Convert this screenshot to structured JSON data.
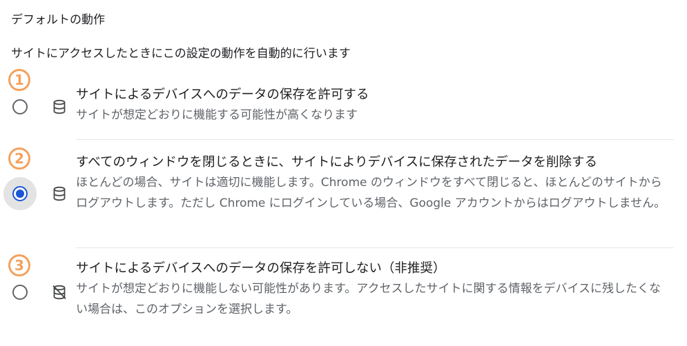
{
  "section": {
    "title": "デフォルトの動作",
    "description": "サイトにアクセスしたときにこの設定の動作を自動的に行います"
  },
  "options": [
    {
      "marker": "1",
      "label": "サイトによるデバイスへのデータの保存を許可する",
      "description": "サイトが想定どおりに機能する可能性が高くなります",
      "selected": false,
      "icon": "database-icon"
    },
    {
      "marker": "2",
      "label": "すべてのウィンドウを閉じるときに、サイトによりデバイスに保存されたデータを削除する",
      "description": "ほとんどの場合、サイトは適切に機能します。Chrome のウィンドウをすべて閉じると、ほとんどのサイトからログアウトします。ただし Chrome にログインしている場合、Google アカウントからはログアウトしません。",
      "selected": true,
      "icon": "database-icon"
    },
    {
      "marker": "3",
      "label": "サイトによるデバイスへのデータの保存を許可しない（非推奨）",
      "description": "サイトが想定どおりに機能しない可能性があります。アクセスしたサイトに関する情報をデバイスに残したくない場合は、このオプションを選択します。",
      "selected": false,
      "icon": "database-off-icon"
    }
  ],
  "colors": {
    "accent": "#1a56d6",
    "marker": "#f4a15d"
  }
}
